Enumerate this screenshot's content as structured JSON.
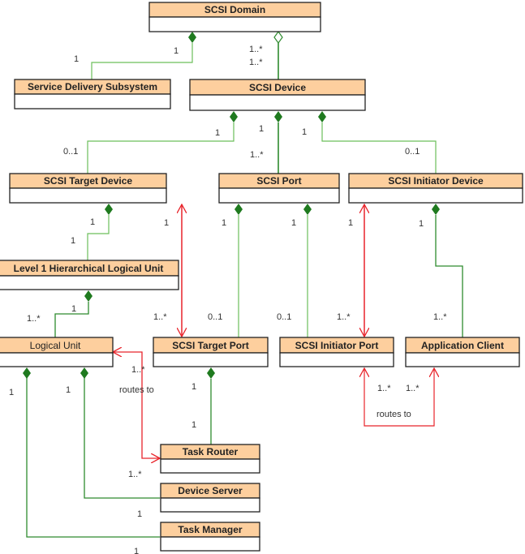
{
  "diagram": {
    "type": "UML class diagram",
    "colors": {
      "class_header": "#fdcf9e",
      "class_border": "#222222",
      "composition_line": "#2e8b2e",
      "composition_line_light": "#6cbf5a",
      "navigation_line": "#e8242b"
    },
    "classes": {
      "scsi_domain": "SCSI Domain",
      "service_delivery_subsystem": "Service Delivery Subsystem",
      "scsi_device": "SCSI Device",
      "scsi_target_device": "SCSI Target Device",
      "scsi_port": "SCSI Port",
      "scsi_initiator_device": "SCSI Initiator Device",
      "level1_hlu": "Level 1 Hierarchical Logical Unit",
      "logical_unit": "Logical Unit",
      "scsi_target_port": "SCSI Target Port",
      "scsi_initiator_port": "SCSI Initiator Port",
      "application_client": "Application Client",
      "task_router": "Task Router",
      "device_server": "Device Server",
      "task_manager": "Task Manager"
    },
    "multiplicities": {
      "domain_sds_whole": "1",
      "domain_sds_part": "1",
      "domain_device_whole": "1..*",
      "domain_device_part": "1..*",
      "device_target_whole": "1",
      "device_target_part": "0..1",
      "device_port_whole": "1",
      "device_port_part": "1..*",
      "device_initiator_whole": "1",
      "device_initiator_part": "0..1",
      "target_hlu_whole": "1",
      "target_hlu_part": "1",
      "target_tport_end1": "1",
      "target_tport_end2": "1..*",
      "port_tport_whole": "1",
      "port_tport_part": "0..1",
      "port_iport_whole": "1",
      "port_iport_part": "0..1",
      "init_iport_end1": "1",
      "init_iport_end2": "1..*",
      "init_app_whole": "1",
      "init_app_part": "1..*",
      "hlu_lu_whole": "1",
      "hlu_lu_part": "1..*",
      "lu_router_mult_top": "1..*",
      "lu_router_mult_bottom": "1..*",
      "lu_tm_whole": "1",
      "lu_ds_whole": "1",
      "tport_router_whole": "1",
      "tport_router_part": "1",
      "ds_part": "1",
      "tm_part": "1",
      "iport_app_end1": "1..*",
      "iport_app_end2": "1..*"
    },
    "labels": {
      "routes_to_left": "routes to",
      "routes_to_right": "routes to"
    }
  }
}
